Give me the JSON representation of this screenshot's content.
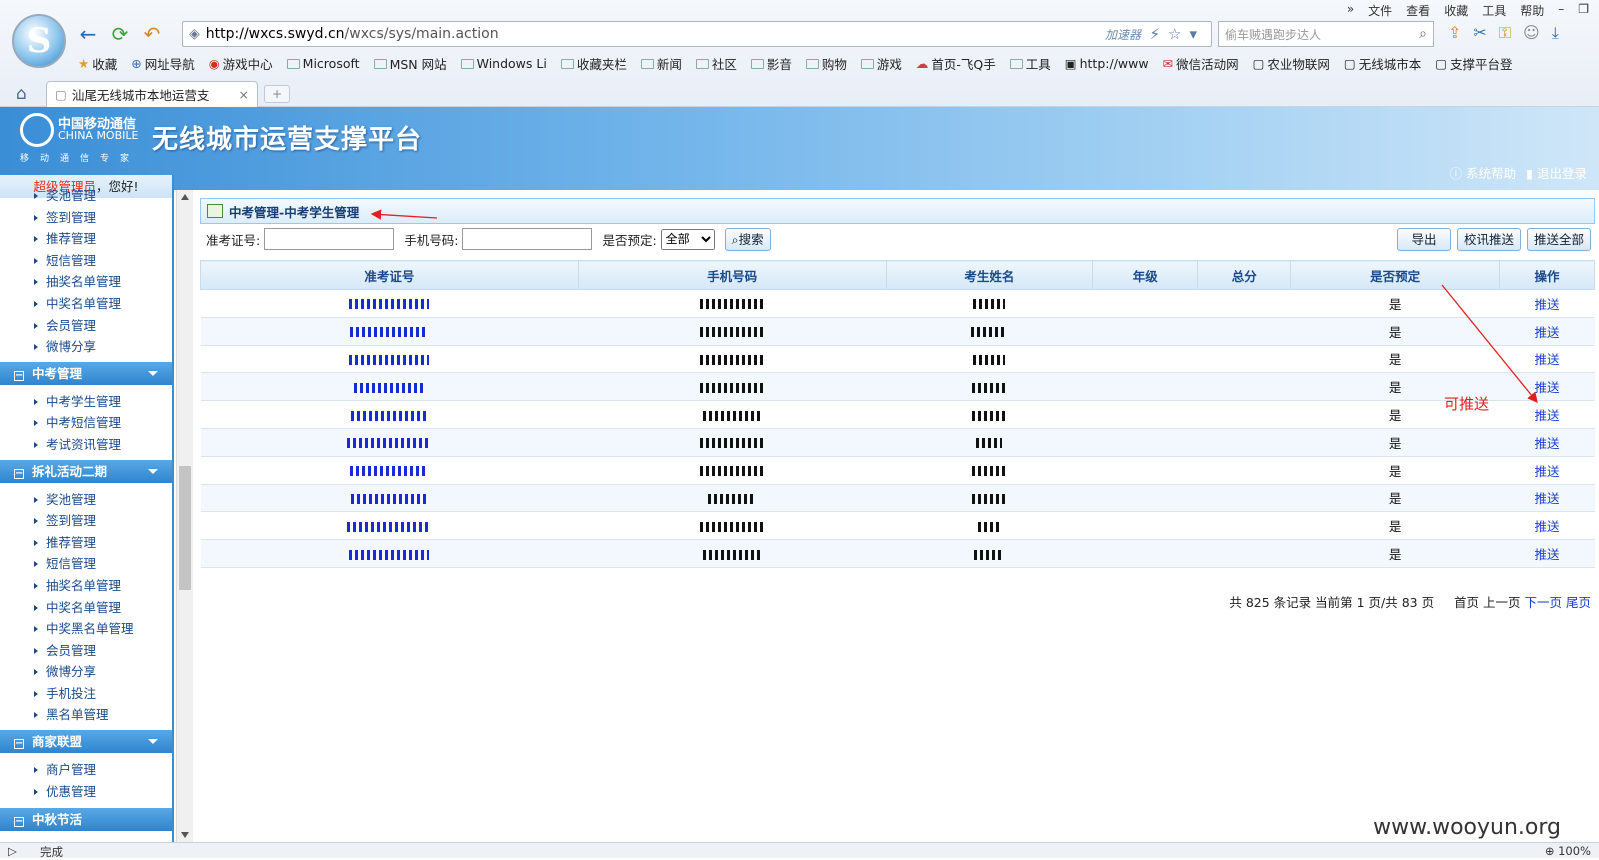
{
  "browser": {
    "menu": [
      "»",
      "文件",
      "查看",
      "收藏",
      "工具",
      "帮助"
    ],
    "url_host": "http://wxcs.swyd.cn",
    "url_path": "/wxcs/sys/main.action",
    "accelerator": "加速器",
    "search_placeholder": "偷车贼遇跑步达人",
    "bookmarks": [
      "收藏",
      "网址导航",
      "游戏中心",
      "Microsoft",
      "MSN 网站",
      "Windows Li",
      "收藏夹栏",
      "新闻",
      "社区",
      "影音",
      "购物",
      "游戏",
      "首页-飞Q手",
      "工具",
      "http://www",
      "微信活动网",
      "农业物联网",
      "无线城市本",
      "支撑平台登"
    ],
    "tab_title": "汕尾无线城市本地运营支",
    "status": "完成",
    "zoom": "100%"
  },
  "header": {
    "logo_cn": "中国移动通信",
    "logo_en": "CHINA MOBILE",
    "logo_sub": "移动通信专家",
    "title": "无线城市运营支撑平台",
    "help": "系统帮助",
    "logout": "退出登录"
  },
  "sidebar": {
    "role": "超级管理员",
    "greeting": "，您好!",
    "top_items": [
      "奖池管理",
      "签到管理",
      "推荐管理",
      "短信管理",
      "抽奖名单管理",
      "中奖名单管理",
      "会员管理",
      "微博分享"
    ],
    "sec1": "中考管理",
    "sec1_items": [
      "中考学生管理",
      "中考短信管理",
      "考试资讯管理"
    ],
    "sec2": "拆礼活动二期",
    "sec2_items": [
      "奖池管理",
      "签到管理",
      "推荐管理",
      "短信管理",
      "抽奖名单管理",
      "中奖名单管理",
      "中奖黑名单管理",
      "会员管理",
      "微博分享",
      "手机投注",
      "黑名单管理"
    ],
    "sec3": "商家联盟",
    "sec3_items": [
      "商户管理",
      "优惠管理"
    ],
    "sec4": "中秋节活"
  },
  "panel": {
    "title": "中考管理-中考学生管理",
    "f_id": "准考证号:",
    "f_phone": "手机号码:",
    "f_reserved": "是否预定:",
    "f_reserved_value": "全部",
    "search_btn": "搜索",
    "export_btn": "导出",
    "push_school_btn": "校讯推送",
    "push_all_btn": "推送全部"
  },
  "table": {
    "headers": [
      "准考证号",
      "手机号码",
      "考生姓名",
      "年级",
      "总分",
      "是否预定",
      "操作"
    ],
    "rows": [
      {
        "reserved": "是",
        "action": "推送"
      },
      {
        "reserved": "是",
        "action": "推送"
      },
      {
        "reserved": "是",
        "action": "推送"
      },
      {
        "reserved": "是",
        "action": "推送"
      },
      {
        "reserved": "是",
        "action": "推送"
      },
      {
        "reserved": "是",
        "action": "推送"
      },
      {
        "reserved": "是",
        "action": "推送"
      },
      {
        "reserved": "是",
        "action": "推送"
      },
      {
        "reserved": "是",
        "action": "推送"
      },
      {
        "reserved": "是",
        "action": "推送"
      }
    ]
  },
  "pager": {
    "summary": "共 825 条记录 当前第 1 页/共 83 页",
    "first": "首页",
    "prev": "上一页",
    "next": "下一页",
    "last": "尾页"
  },
  "annotation": "可推送",
  "watermark": "www.wooyun.org",
  "colors": {
    "accent": "#3c8ed2",
    "link": "#1a3fd0",
    "annotation": "#e02020"
  }
}
